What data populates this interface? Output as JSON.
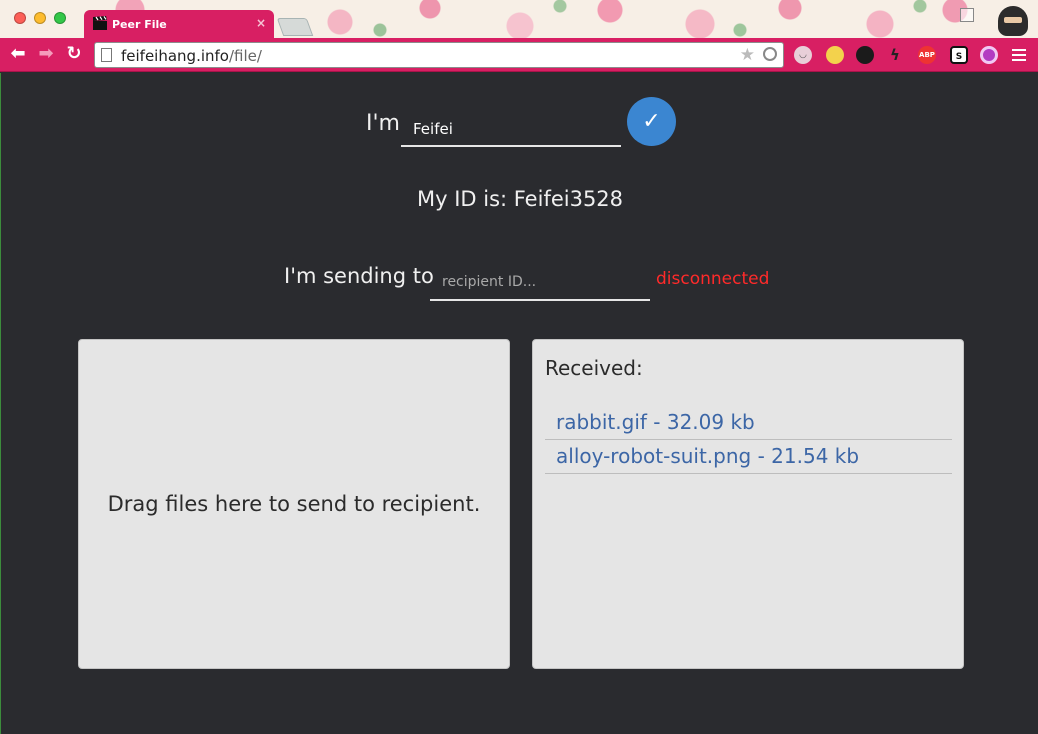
{
  "browser": {
    "tab_title": "Peer File",
    "tab_close_glyph": "×",
    "url_host": "feifeihang.info",
    "url_path": "/file/",
    "extension_labels": [
      "ABP",
      "S"
    ]
  },
  "identity": {
    "im_label": "I'm",
    "name_value": "Feifei",
    "confirm_glyph": "✓",
    "my_id_text": "My ID is: Feifei3528"
  },
  "recipient": {
    "sending_label": "I'm sending to",
    "placeholder": "recipient ID...",
    "status_text": "disconnected",
    "status_color": "#ff2a2a"
  },
  "drop_zone": {
    "text": "Drag files here to send to recipient."
  },
  "received": {
    "title": "Received:",
    "files": [
      "rabbit.gif - 32.09 kb",
      "alloy-robot-suit.png - 21.54 kb"
    ]
  },
  "colors": {
    "browser_accent": "#d81f63",
    "page_background": "#2a2b2f",
    "confirm_button": "#3b86d1",
    "link_color": "#3c66a6"
  }
}
